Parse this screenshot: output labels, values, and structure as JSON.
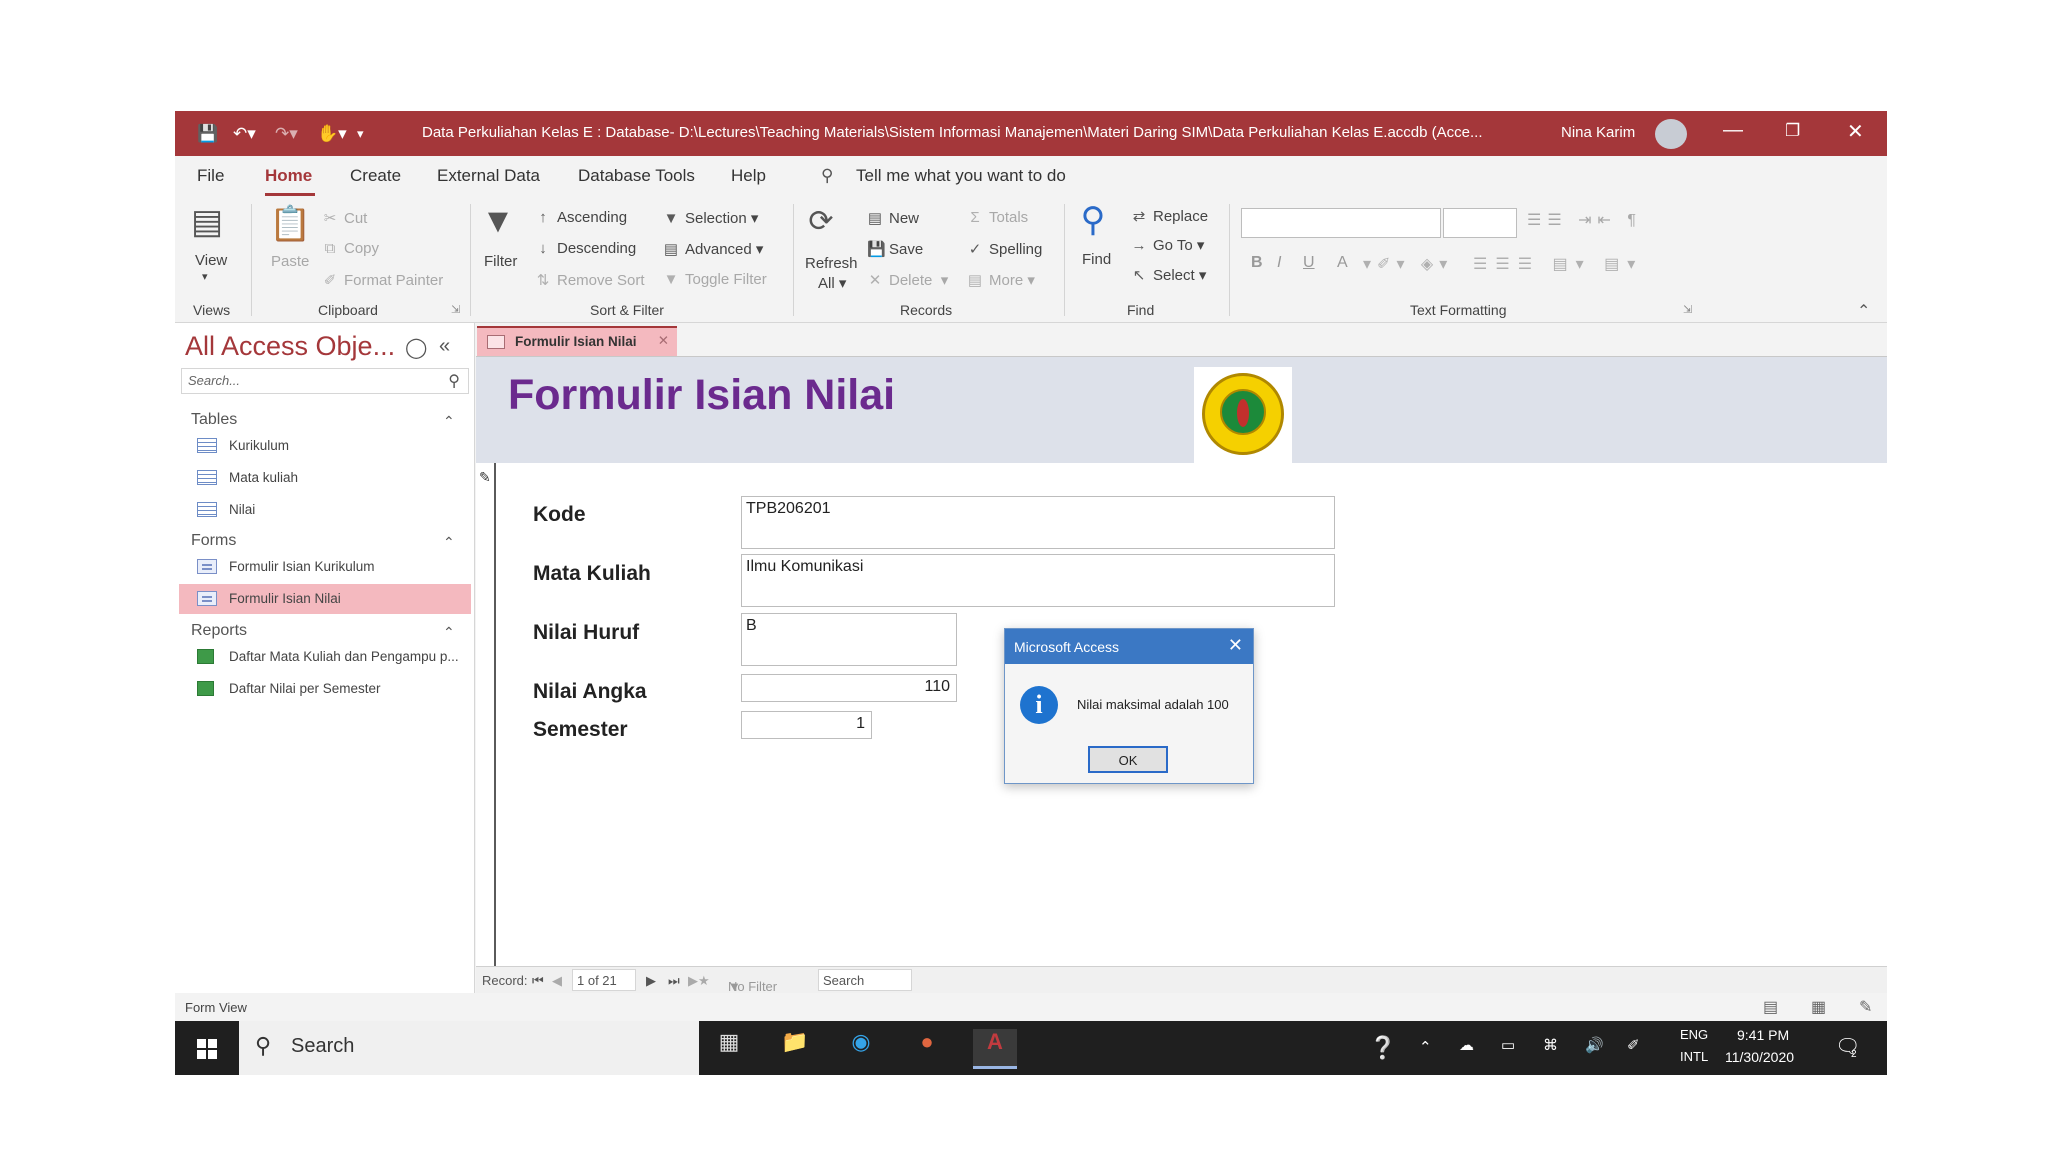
{
  "window": {
    "title": "Data Perkuliahan Kelas E : Database- D:\\Lectures\\Teaching Materials\\Sistem Informasi Manajemen\\Materi Daring SIM\\Data Perkuliahan Kelas E.accdb (Acce...",
    "user": "Nina Karim",
    "accent_color": "#a4373a"
  },
  "menu": {
    "tabs": [
      "File",
      "Home",
      "Create",
      "External Data",
      "Database Tools",
      "Help"
    ],
    "active_tab": "Home",
    "tell_me": "Tell me what you want to do"
  },
  "ribbon": {
    "views": {
      "view": "View",
      "group": "Views"
    },
    "clipboard": {
      "paste": "Paste",
      "cut": "Cut",
      "copy": "Copy",
      "format_painter": "Format Painter",
      "group": "Clipboard"
    },
    "sort_filter": {
      "filter": "Filter",
      "ascending": "Ascending",
      "descending": "Descending",
      "remove_sort": "Remove Sort",
      "selection": "Selection",
      "advanced": "Advanced",
      "toggle_filter": "Toggle Filter",
      "group": "Sort & Filter"
    },
    "records": {
      "refresh": "Refresh",
      "all": "All",
      "new": "New",
      "save": "Save",
      "delete": "Delete",
      "totals": "Totals",
      "spelling": "Spelling",
      "more": "More",
      "group": "Records"
    },
    "find": {
      "find": "Find",
      "replace": "Replace",
      "goto": "Go To",
      "select": "Select",
      "group": "Find"
    },
    "text_formatting": {
      "group": "Text Formatting",
      "bold": "B",
      "italic": "I",
      "underline": "U",
      "font_color": "A"
    }
  },
  "nav": {
    "title": "All Access Obje...",
    "search_placeholder": "Search...",
    "groups": [
      {
        "name": "Tables",
        "items": [
          "Kurikulum",
          "Mata kuliah",
          "Nilai"
        ]
      },
      {
        "name": "Forms",
        "items": [
          "Formulir Isian Kurikulum",
          "Formulir Isian Nilai"
        ]
      },
      {
        "name": "Reports",
        "items": [
          "Daftar Mata Kuliah dan Pengampu p...",
          "Daftar Nilai per Semester"
        ]
      }
    ],
    "selected_item": "Formulir Isian Nilai"
  },
  "document_tab": "Formulir Isian Nilai",
  "form": {
    "title": "Formulir Isian Nilai",
    "logo_icon": "university-seal",
    "fields": [
      {
        "label": "Kode",
        "value": "TPB206201"
      },
      {
        "label": "Mata Kuliah",
        "value": "Ilmu Komunikasi"
      },
      {
        "label": "Nilai Huruf",
        "value": "B"
      },
      {
        "label": "Nilai Angka",
        "value": "110"
      },
      {
        "label": "Semester",
        "value": "1"
      }
    ]
  },
  "record_nav": {
    "label": "Record:",
    "position": "1 of 21",
    "no_filter": "No Filter",
    "search": "Search"
  },
  "status": {
    "text": "Form View"
  },
  "dialog": {
    "title": "Microsoft Access",
    "message": "Nilai maksimal adalah 100",
    "ok": "OK",
    "icon": "info-icon"
  },
  "taskbar": {
    "search": "Search",
    "lang_top": "ENG",
    "lang_bottom": "INTL",
    "time": "9:41 PM",
    "date": "11/30/2020",
    "notification_count": "2"
  }
}
